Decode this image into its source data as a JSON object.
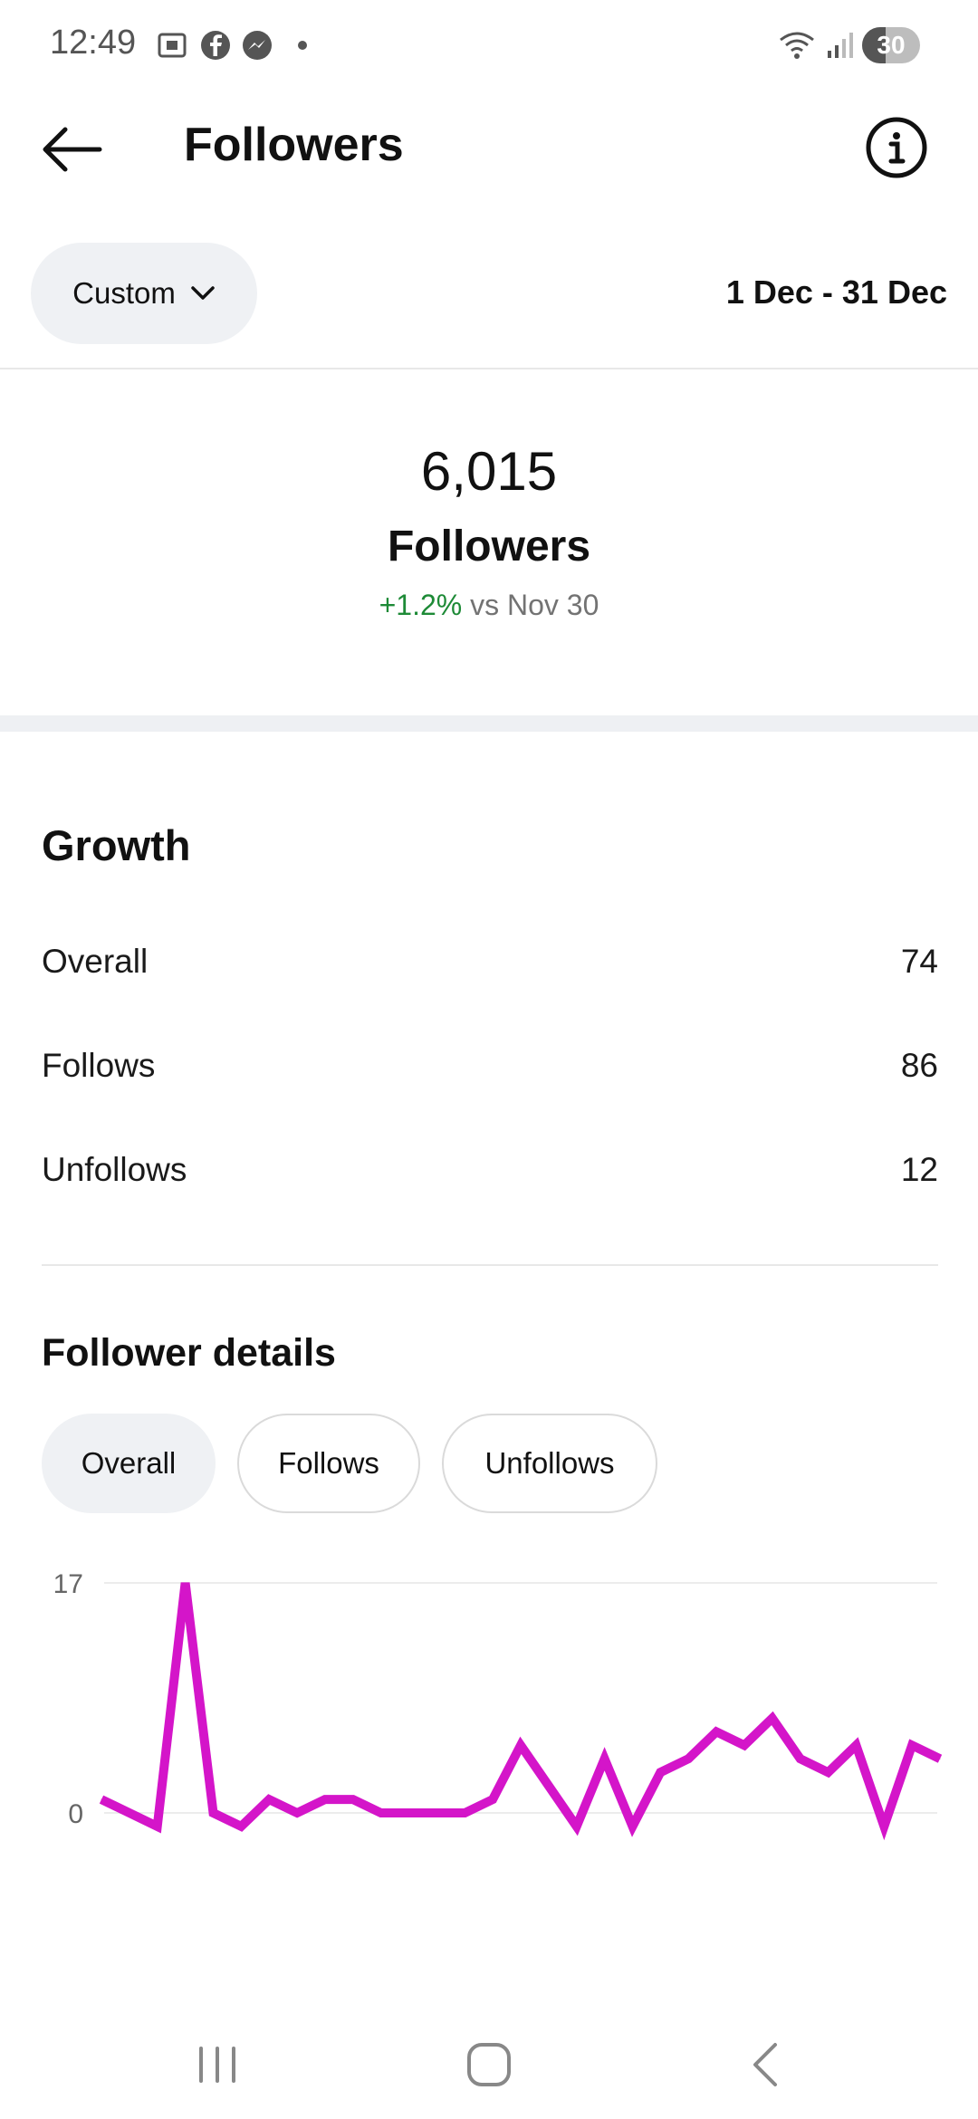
{
  "status_bar": {
    "time": "12:49",
    "battery": "30",
    "icons": [
      "screenshot-icon",
      "facebook-icon",
      "messenger-icon",
      "dot-icon",
      "wifi-icon",
      "signal-icon",
      "battery-icon"
    ]
  },
  "header": {
    "title": "Followers",
    "back_icon": "back-arrow-icon",
    "info_icon": "info-icon"
  },
  "filter": {
    "range_label": "Custom",
    "date_range": "1 Dec - 31 Dec"
  },
  "summary": {
    "count": "6,015",
    "label": "Followers",
    "change": "+1.2%",
    "change_suffix": "vs Nov 30",
    "change_color": "#1d8a36"
  },
  "growth": {
    "title": "Growth",
    "rows": [
      {
        "label": "Overall",
        "value": "74"
      },
      {
        "label": "Follows",
        "value": "86"
      },
      {
        "label": "Unfollows",
        "value": "12"
      }
    ]
  },
  "details": {
    "title": "Follower details",
    "tabs": [
      "Overall",
      "Follows",
      "Unfollows"
    ],
    "active_tab": "Overall"
  },
  "chart_data": {
    "type": "line",
    "x": [
      1,
      2,
      3,
      4,
      5,
      6,
      7,
      8,
      9,
      10,
      11,
      12,
      13,
      14,
      15,
      16,
      17,
      18,
      19,
      20,
      21,
      22,
      23,
      24,
      25,
      26,
      27,
      28,
      29,
      30,
      31
    ],
    "series": [
      {
        "values": [
          1,
          0,
          -1,
          17,
          0,
          -1,
          1,
          0,
          1,
          1,
          0,
          0,
          0,
          0,
          1,
          5,
          2,
          -1,
          4,
          -1,
          3,
          4,
          6,
          5,
          7,
          4,
          3,
          5,
          -1,
          5,
          4
        ]
      }
    ],
    "ylim": [
      0,
      17
    ],
    "y_ticks": [
      "17",
      "0"
    ],
    "line_color": "#d415c9",
    "grid": true
  },
  "nav_bar": {
    "icons": [
      "recent-apps-icon",
      "home-icon",
      "back-nav-icon"
    ]
  }
}
